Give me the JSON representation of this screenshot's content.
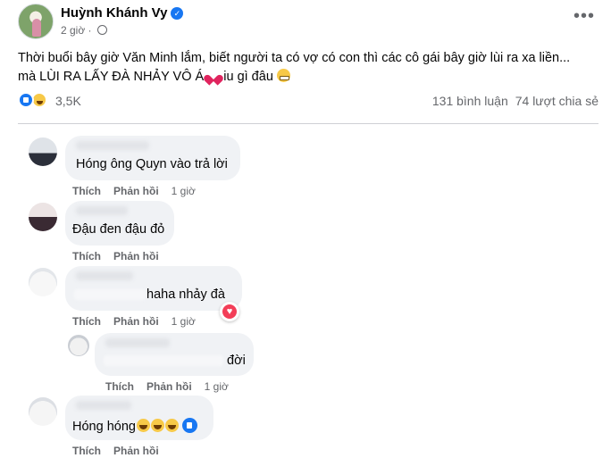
{
  "post": {
    "author": "Huỳnh Khánh Vy",
    "time": "2 giờ",
    "line1": "Thời buổi bây giờ Văn Minh lắm, biết người ta có vợ có con thì các cô gái bây giờ lùi ra xa liền...",
    "line2_a": "mà LÙI RA LẤY ĐÀ NHẢY VÔ Á",
    "line2_b": "iu gì đâu",
    "reaction_count": "3,5K",
    "comments_count": "131 bình luận",
    "shares_count": "74 lượt chia sẻ"
  },
  "actions": {
    "like": "Thích",
    "reply": "Phản hồi"
  },
  "comments": [
    {
      "text": "Hóng ông Quyn vào trả lời",
      "time": "1 giờ"
    },
    {
      "text": "Đậu đen đậu đỏ",
      "time": ""
    },
    {
      "text": "haha nhảy đà",
      "time": "1 giờ"
    },
    {
      "text": "đời",
      "time": "1 giờ"
    },
    {
      "text": "Hóng hóng",
      "time": ""
    }
  ],
  "icons": [
    "verified-icon",
    "globe-icon",
    "more-icon",
    "like-reaction-icon",
    "haha-reaction-icon",
    "heart-emoji",
    "grimace-emoji",
    "love-reaction-icon",
    "laugh-emoji",
    "like-icon"
  ],
  "colors": {
    "accent": "#1877f2",
    "bubble": "#f0f2f5",
    "secondary_text": "#65676b",
    "love": "#f33e58"
  }
}
